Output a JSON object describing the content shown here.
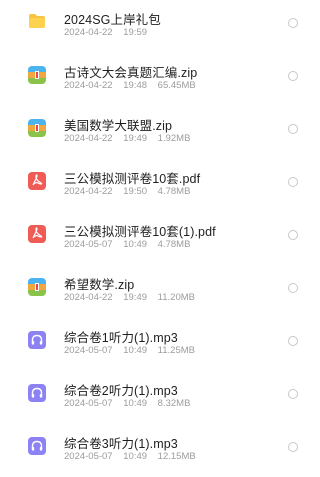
{
  "files": [
    {
      "name": "2024SG上岸礼包",
      "date": "2024-04-22",
      "time": "19:59",
      "size": "",
      "icon": "folder-icon"
    },
    {
      "name": "古诗文大会真题汇编.zip",
      "date": "2024-04-22",
      "time": "19:48",
      "size": "65.45MB",
      "icon": "zip-icon"
    },
    {
      "name": "美国数学大联盟.zip",
      "date": "2024-04-22",
      "time": "19:49",
      "size": "1.92MB",
      "icon": "zip-icon"
    },
    {
      "name": "三公模拟测评卷10套.pdf",
      "date": "2024-04-22",
      "time": "19:50",
      "size": "4.78MB",
      "icon": "pdf-icon"
    },
    {
      "name": "三公模拟测评卷10套(1).pdf",
      "date": "2024-05-07",
      "time": "10:49",
      "size": "4.78MB",
      "icon": "pdf-icon"
    },
    {
      "name": "希望数学.zip",
      "date": "2024-04-22",
      "time": "19:49",
      "size": "11.20MB",
      "icon": "zip-icon"
    },
    {
      "name": "综合卷1听力(1).mp3",
      "date": "2024-05-07",
      "time": "10:49",
      "size": "11.25MB",
      "icon": "audio-icon"
    },
    {
      "name": "综合卷2听力(1).mp3",
      "date": "2024-05-07",
      "time": "10:49",
      "size": "8.32MB",
      "icon": "audio-icon"
    },
    {
      "name": "综合卷3听力(1).mp3",
      "date": "2024-05-07",
      "time": "10:49",
      "size": "12.15MB",
      "icon": "audio-icon"
    }
  ]
}
